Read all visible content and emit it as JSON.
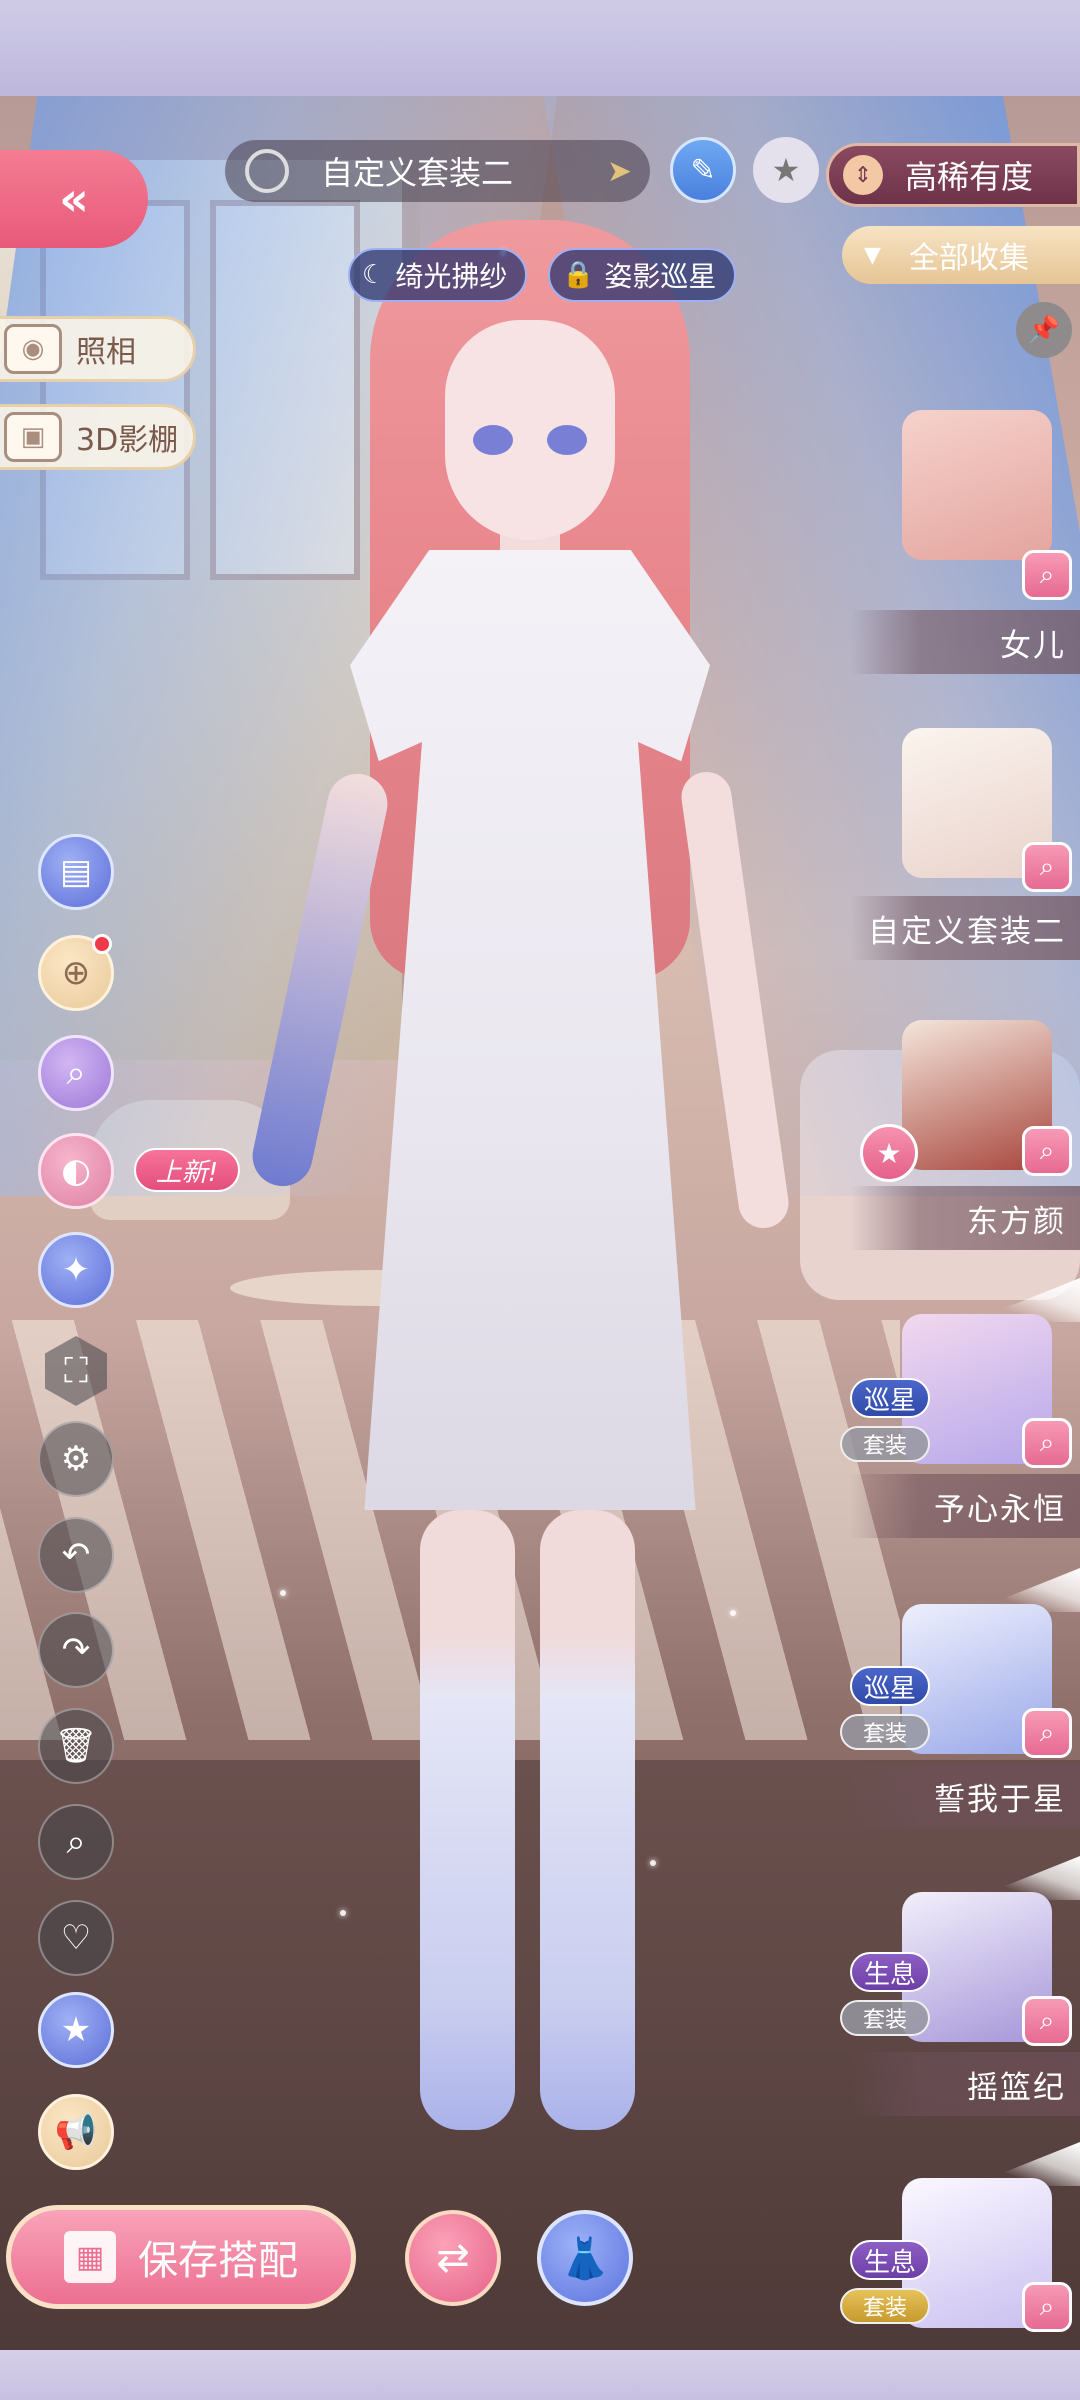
{
  "header": {
    "back_icon": "double-chevron-left",
    "outfit_name": "自定义套装二",
    "rarity_label": "高稀有度",
    "collection_label": "全部收集"
  },
  "tags": [
    {
      "label": "绮光拂纱",
      "icon": "moon-icon"
    },
    {
      "label": "姿影巡星",
      "icon": "lock-icon"
    }
  ],
  "left_tools": {
    "photo_label": "照相",
    "studio_label": "3D影棚",
    "new_badge": "上新!"
  },
  "bottom": {
    "save_label": "保存搭配"
  },
  "items": [
    {
      "name": "女儿",
      "colors": [
        "#f3c7c1",
        "#e4a49e"
      ]
    },
    {
      "name": "自定义套装二",
      "colors": [
        "#f8efe6",
        "#e9d2cb"
      ]
    },
    {
      "name": "东方颜",
      "colors": [
        "#a8463c",
        "#f4e6dc"
      ]
    },
    {
      "name": "予心永恒",
      "badge": "巡星",
      "suit": "套装",
      "colors": [
        "#e9c7ea",
        "#b6a6ea"
      ]
    },
    {
      "name": "誓我于星",
      "badge": "巡星",
      "suit": "套装",
      "colors": [
        "#dfe2fb",
        "#9aa8e9"
      ]
    },
    {
      "name": "摇篮纪",
      "badge": "生息",
      "suit": "套装",
      "colors": [
        "#e8e2f7",
        "#a596d9"
      ]
    },
    {
      "badge": "生息",
      "suit": "套装",
      "colors": [
        "#f1ecfb",
        "#c9bff0"
      ]
    }
  ],
  "colors": {
    "accent_pink": "#ec6f91",
    "accent_blue": "#5d73de",
    "badge_star": "#2f4aa8",
    "badge_life": "#6c3fa8"
  }
}
